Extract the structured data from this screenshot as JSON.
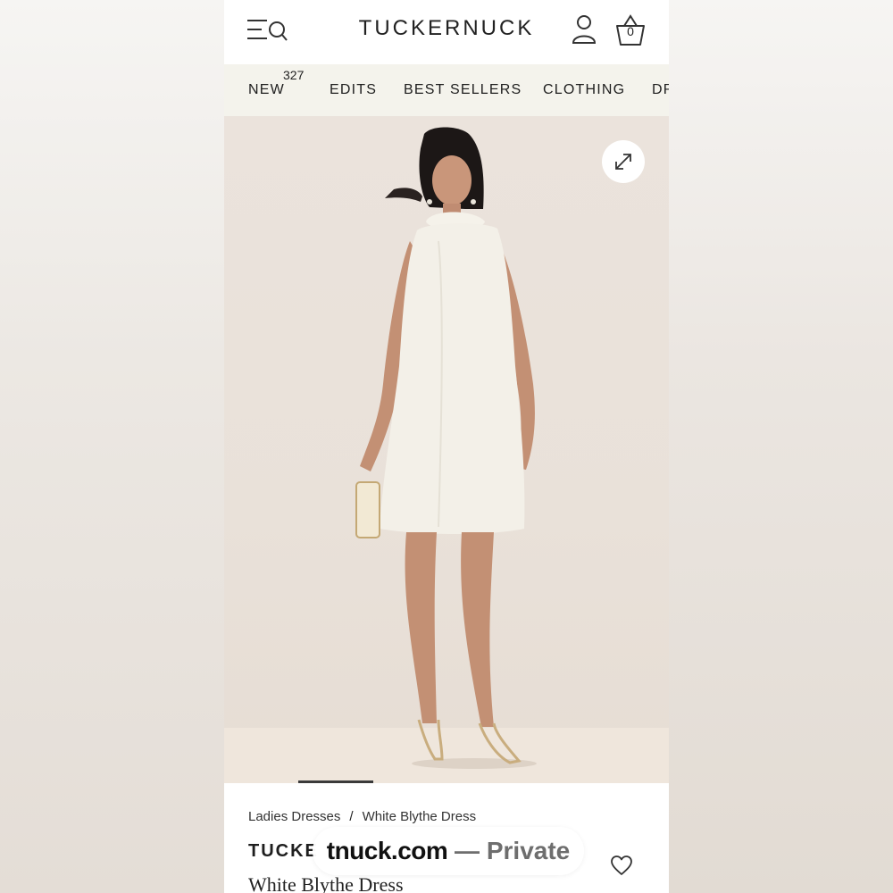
{
  "header": {
    "logo": "TUCKERNUCK",
    "bag_count": "0"
  },
  "nav": {
    "items": [
      {
        "label": "NEW",
        "badge": "327"
      },
      {
        "label": "EDITS"
      },
      {
        "label": "BEST SELLERS"
      },
      {
        "label": "CLOTHING"
      },
      {
        "label": "DR"
      }
    ]
  },
  "gallery": {
    "slide_position": 0.25
  },
  "product": {
    "breadcrumb": [
      "Ladies Dresses",
      "/",
      "White Blythe Dress"
    ],
    "brand": "TUCKE",
    "name": "White Blythe Dress"
  },
  "browser": {
    "url_domain": "tnuck.com",
    "url_separator": " — ",
    "url_label": "Private"
  },
  "icons": {
    "menu": "menu-search-icon",
    "account": "account-icon",
    "bag": "shopping-bag-icon",
    "expand": "expand-icon",
    "wishlist": "heart-icon"
  }
}
